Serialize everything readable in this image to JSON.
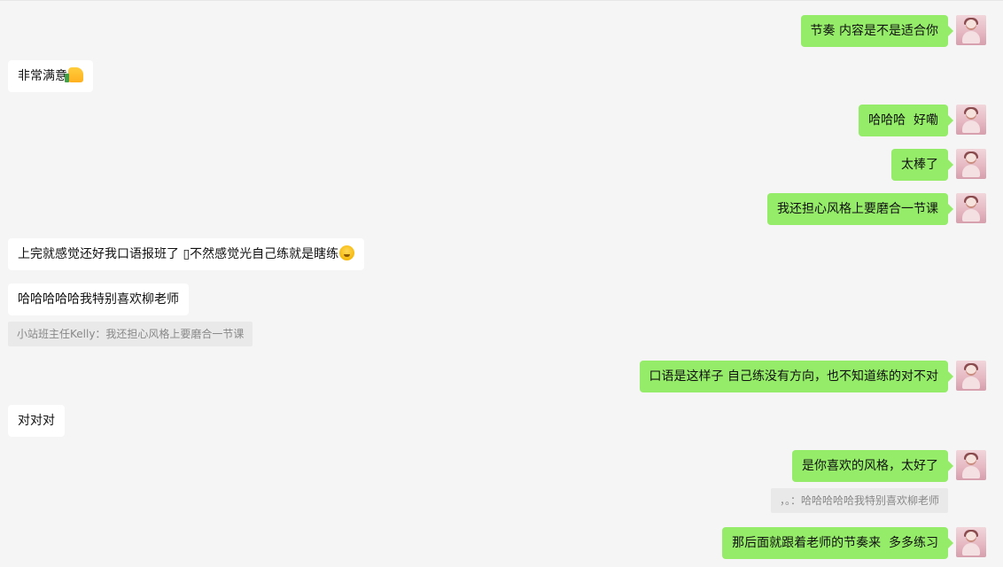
{
  "messages": [
    {
      "side": "right",
      "text": "节奏 内容是不是适合你"
    },
    {
      "side": "left",
      "text": "非常满意",
      "emoji": "thumbs-up-emoji"
    },
    {
      "side": "right",
      "text": "哈哈哈  好嘞"
    },
    {
      "side": "right",
      "text": "太棒了"
    },
    {
      "side": "right",
      "text": "我还担心风格上要磨合一节课"
    },
    {
      "side": "left",
      "text": "上完就感觉还好我口语报班了 \u0000不然感觉光自己练就是瞎练",
      "emoji": "sweat-smile-emoji"
    },
    {
      "side": "left",
      "text": "哈哈哈哈哈我特别喜欢柳老师"
    },
    {
      "side": "left",
      "quote": "小站班主任Kelly：我还担心风格上要磨合一节课"
    },
    {
      "side": "right",
      "text": "口语是这样子 自己练没有方向，也不知道练的对不对"
    },
    {
      "side": "left",
      "text": "对对对"
    },
    {
      "side": "right",
      "text": "是你喜欢的风格，太好了"
    },
    {
      "side": "right",
      "quote": "，。：哈哈哈哈哈我特别喜欢柳老师"
    },
    {
      "side": "right",
      "text": "那后面就跟着老师的节奏来  多多练习"
    }
  ],
  "colors": {
    "mine_bubble": "#95ec69",
    "their_bubble": "#ffffff",
    "background": "#f5f5f5",
    "quote_bg": "#e9e9e9"
  }
}
